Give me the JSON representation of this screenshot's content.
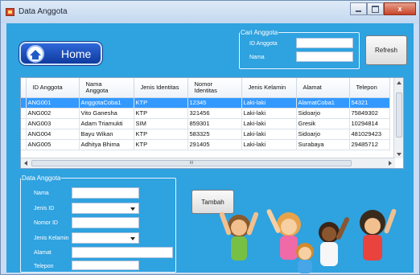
{
  "window": {
    "title": "Data Anggota",
    "close_label": "x"
  },
  "home_button": {
    "label": "Home"
  },
  "search": {
    "legend": "Cari Anggota",
    "id_label": "ID Anggota",
    "name_label": "Nama",
    "id_value": "",
    "name_value": ""
  },
  "refresh_button": {
    "label": "Refresh"
  },
  "table": {
    "headers": [
      "ID Anggota",
      "Nama\nAnggota",
      "Jenis Identitas",
      "Nomor\nIdentitas",
      "Jenis Kelamin",
      "Alamat",
      "Telepon"
    ],
    "rows": [
      {
        "id": "ANG001",
        "nama": "AnggotaCoba1",
        "jenis_identitas": "KTP",
        "nomor": "12345",
        "kelamin": "Laki-laki",
        "alamat": "AlamatCoba1",
        "telepon": "54321"
      },
      {
        "id": "ANG002",
        "nama": "Vito Ganesha",
        "jenis_identitas": "KTP",
        "nomor": "321456",
        "kelamin": "Laki-laki",
        "alamat": "Sidoarjo",
        "telepon": "75849302"
      },
      {
        "id": "ANG003",
        "nama": "Adam Triamukti",
        "jenis_identitas": "SIM",
        "nomor": "859301",
        "kelamin": "Laki-laki",
        "alamat": "Gresik",
        "telepon": "10294814"
      },
      {
        "id": "ANG004",
        "nama": "Bayu Wikan",
        "jenis_identitas": "KTP",
        "nomor": "583325",
        "kelamin": "Laki-laki",
        "alamat": "Sidoarjo",
        "telepon": "481029423"
      },
      {
        "id": "ANG005",
        "nama": "Adhitya Bhima",
        "jenis_identitas": "KTP",
        "nomor": "291405",
        "kelamin": "Laki-laki",
        "alamat": "Surabaya",
        "telepon": "29485712"
      }
    ],
    "scroll_grip": "III"
  },
  "form": {
    "legend": "Data Anggota",
    "nama_label": "Nama",
    "jenis_id_label": "Jenis ID",
    "nomor_id_label": "Nomor ID",
    "jenis_kelamin_label": "Jenis Kelamin",
    "alamat_label": "Alamat",
    "telepon_label": "Telepon",
    "nama_value": "",
    "jenis_id_value": "",
    "nomor_id_value": "",
    "jenis_kelamin_value": "",
    "alamat_value": "",
    "telepon_value": ""
  },
  "tambah_button": {
    "label": "Tambah"
  },
  "colors": {
    "client_bg": "#2fa2e0",
    "selection": "#3399ff",
    "home_button": "#1f4fc0"
  }
}
